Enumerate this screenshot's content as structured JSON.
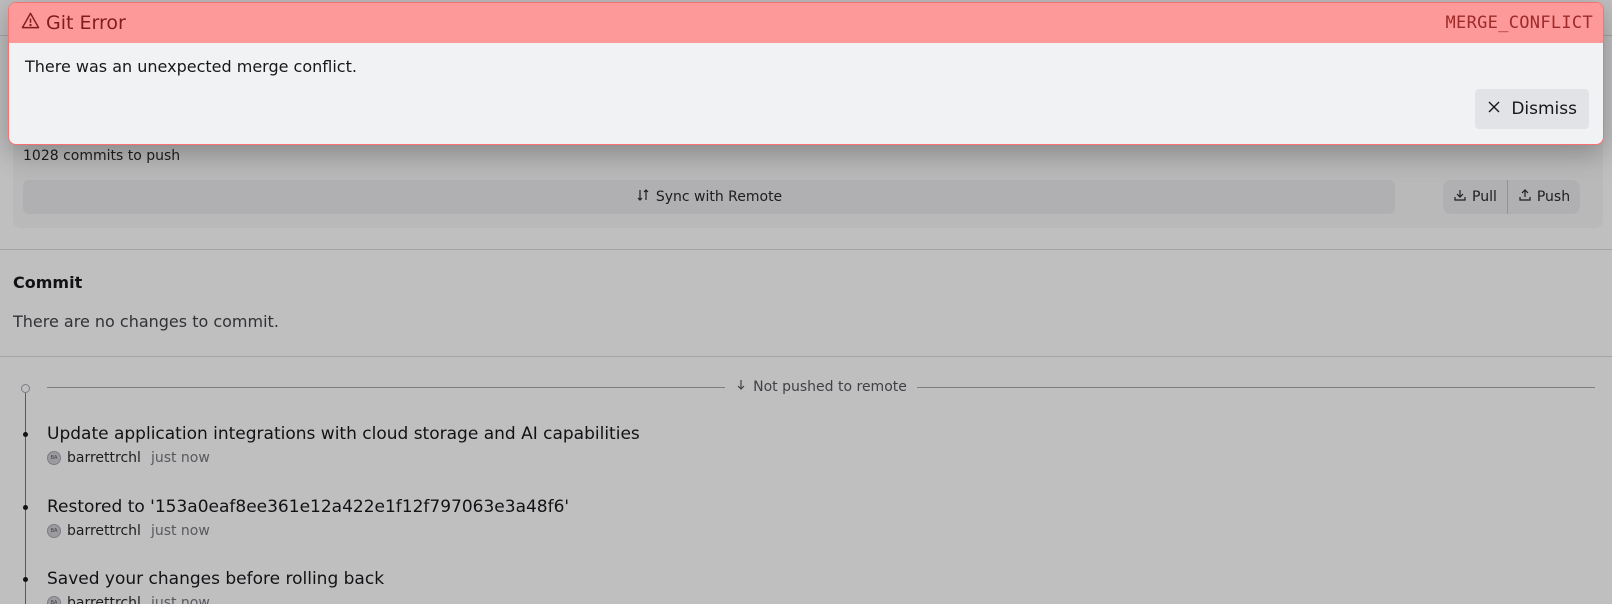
{
  "remote": {
    "commits_to_push": "1028 commits to push",
    "sync_label": "Sync with Remote",
    "pull_label": "Pull",
    "push_label": "Push"
  },
  "commit_section": {
    "title": "Commit",
    "empty_message": "There are no changes to commit."
  },
  "history": {
    "not_pushed_label": "Not pushed to remote",
    "commits": [
      {
        "title": "Update application integrations with cloud storage and AI capabilities",
        "author": "barrettrchl",
        "time": "just now",
        "avatar_initials": "BA"
      },
      {
        "title": "Restored to '153a0eaf8ee361e12a422e1f12f797063e3a48f6'",
        "author": "barrettrchl",
        "time": "just now",
        "avatar_initials": "BA"
      },
      {
        "title": "Saved your changes before rolling back",
        "author": "barrettrchl",
        "time": "just now",
        "avatar_initials": "BA"
      }
    ]
  },
  "error_dialog": {
    "title": "Git Error",
    "code": "MERGE_CONFLICT",
    "message": "There was an unexpected merge conflict.",
    "dismiss_label": "Dismiss",
    "header_color": "#fd9999",
    "border_color": "#f87171"
  }
}
